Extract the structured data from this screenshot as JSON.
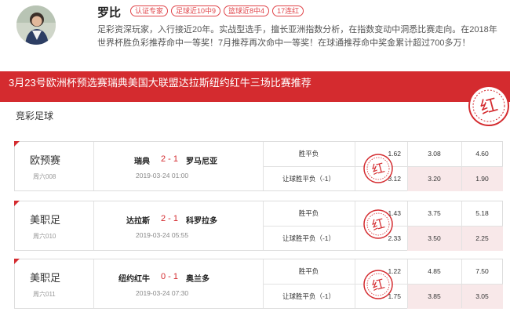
{
  "profile": {
    "name": "罗比",
    "badges": [
      "认证专家",
      "足球近10中9",
      "篮球近8中4",
      "17连红"
    ],
    "description": "足彩资深玩家，入行接近20年。实战型选手，擅长亚洲指数分析，在指数变动中洞悉比赛走向。在2018年世界杯胜负彩推荐命中一等奖！7月推荐再次命中一等奖！在球通推荐命中奖金累计超过700多万！"
  },
  "banner": {
    "title": "3月23号欧洲杯预选赛瑞典美国大联盟达拉斯纽约红牛三场比赛推荐"
  },
  "stamp_text": "红",
  "section_title": "竞彩足球",
  "colors": {
    "accent": "#d42b2f",
    "highlight": "#f8e8e9"
  },
  "matches": [
    {
      "league": "欧预赛",
      "week": "周六008",
      "home": "瑞典",
      "score": "2 - 1",
      "away": "罗马尼亚",
      "time": "2019-03-24 01:00",
      "rows": [
        {
          "label": "胜平负",
          "odds": [
            "1.62",
            "3.08",
            "4.60"
          ]
        },
        {
          "label": "让球胜平负（-1）",
          "odds": [
            "3.12",
            "3.20",
            "1.90"
          ]
        }
      ]
    },
    {
      "league": "美职足",
      "week": "周六010",
      "home": "达拉斯",
      "score": "2 - 1",
      "away": "科罗拉多",
      "time": "2019-03-24 05:55",
      "rows": [
        {
          "label": "胜平负",
          "odds": [
            "1.43",
            "3.75",
            "5.18"
          ]
        },
        {
          "label": "让球胜平负（-1）",
          "odds": [
            "2.33",
            "3.50",
            "2.25"
          ]
        }
      ]
    },
    {
      "league": "美职足",
      "week": "周六011",
      "home": "纽约红牛",
      "score": "0 - 1",
      "away": "奥兰多",
      "time": "2019-03-24 07:30",
      "rows": [
        {
          "label": "胜平负",
          "odds": [
            "1.22",
            "4.85",
            "7.50"
          ]
        },
        {
          "label": "让球胜平负（-1）",
          "odds": [
            "1.75",
            "3.85",
            "3.05"
          ]
        }
      ]
    }
  ]
}
